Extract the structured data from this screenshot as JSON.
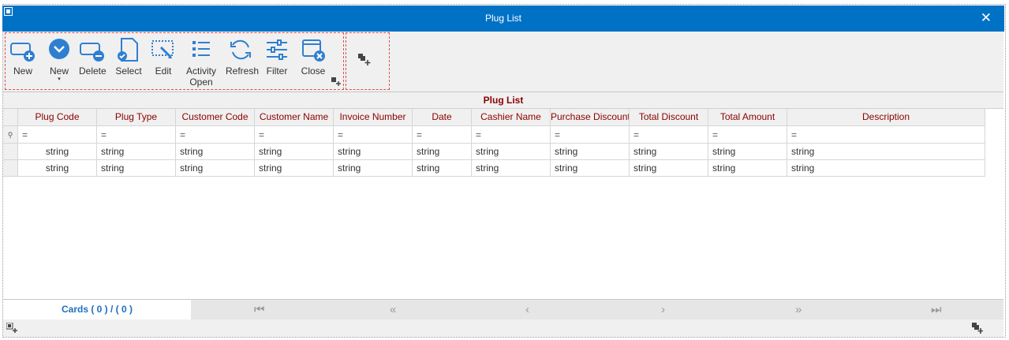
{
  "window": {
    "title": "Plug List",
    "close_glyph": "✕"
  },
  "toolbar": {
    "buttons": [
      {
        "label": "New",
        "icon": "new-card-icon"
      },
      {
        "label": "New",
        "icon": "dropdown-circle-icon",
        "sub": "▾"
      },
      {
        "label": "Delete",
        "icon": "delete-card-icon"
      },
      {
        "label": "Select",
        "icon": "select-document-icon"
      },
      {
        "label": "Edit",
        "icon": "edit-icon"
      },
      {
        "label": "Activity",
        "label2": "Open",
        "icon": "activity-list-icon"
      },
      {
        "label": "Refresh",
        "icon": "refresh-icon"
      },
      {
        "label": "Filter",
        "icon": "filter-icon"
      },
      {
        "label": "Close",
        "icon": "close-card-icon"
      }
    ]
  },
  "grid": {
    "title": "Plug List",
    "columns": [
      "Plug Code",
      "Plug Type",
      "Customer Code",
      "Customer Name",
      "Invoice Number",
      "Date",
      "Cashier Name",
      "Purchase Discount",
      "Total Discount",
      "Total Amount",
      "Description"
    ],
    "filter_glyph": "=",
    "filter_row_icon": "pin-icon",
    "rows": [
      [
        "string",
        "string",
        "string",
        "string",
        "string",
        "string",
        "string",
        "string",
        "string",
        "string",
        "string"
      ],
      [
        "string",
        "string",
        "string",
        "string",
        "string",
        "string",
        "string",
        "string",
        "string",
        "string",
        "string"
      ]
    ]
  },
  "footer": {
    "cards_label": "Cards ( 0 ) / ( 0 )",
    "nav": [
      "first-page-icon",
      "fast-back-icon",
      "previous-icon",
      "next-icon",
      "fast-forward-icon",
      "last-page-icon"
    ]
  },
  "colors": {
    "titlebar": "#0072c6",
    "header_text": "#8b0000",
    "accent": "#1e6fc0",
    "icon_blue": "#2f7fd1"
  }
}
